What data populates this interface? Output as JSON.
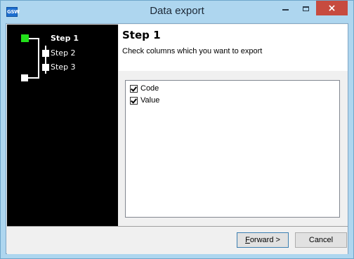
{
  "window": {
    "title": "Data export",
    "app_icon_text": "GSW",
    "close_glyph": "×"
  },
  "steps": [
    {
      "label": "Step 1",
      "active": true
    },
    {
      "label": "Step 2",
      "active": false
    },
    {
      "label": "Step 3",
      "active": false
    }
  ],
  "header": {
    "title": "Step 1",
    "description": "Check columns which you want to export"
  },
  "columns": [
    {
      "label": "Code",
      "checked": true
    },
    {
      "label": "Value",
      "checked": true
    }
  ],
  "footer": {
    "forward_mnemonic": "F",
    "forward_rest": "orward >",
    "cancel_label": "Cancel"
  },
  "colors": {
    "title_bar": "#aed6ef",
    "close_button": "#c74b3f",
    "active_step_node": "#22e01a",
    "steps_panel": "#000000"
  },
  "icons": {
    "app": "gsw-app-icon",
    "minimize": "minimize-icon",
    "maximize": "maximize-icon",
    "close": "close-icon",
    "checkbox": "checkbox-checked-icon"
  }
}
